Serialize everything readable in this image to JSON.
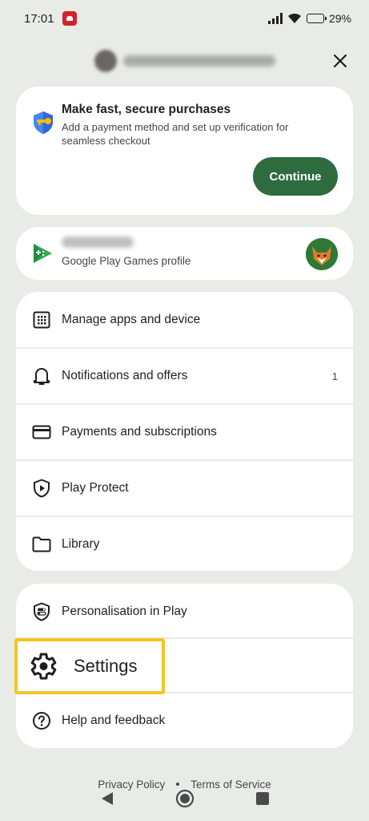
{
  "status_bar": {
    "time": "17:01",
    "battery_text": "29%",
    "battery_level": 0.29
  },
  "header": {
    "close_label": "×"
  },
  "promo": {
    "title": "Make fast, secure purchases",
    "subtitle": "Add a payment method and set up verification for seamless checkout",
    "button_label": "Continue"
  },
  "games_profile": {
    "label": "Google Play Games profile"
  },
  "menu": {
    "items": [
      {
        "label": "Manage apps and device",
        "icon": "grid-icon"
      },
      {
        "label": "Notifications and offers",
        "icon": "bell-icon",
        "count": "1"
      },
      {
        "label": "Payments and subscriptions",
        "icon": "credit-card-icon"
      },
      {
        "label": "Play Protect",
        "icon": "shield-play-icon"
      },
      {
        "label": "Library",
        "icon": "folder-icon"
      }
    ]
  },
  "menu2": {
    "items": [
      {
        "label": "Personalisation in Play",
        "icon": "shield-toggle-icon"
      },
      {
        "label": "Settings",
        "icon": "gear-icon"
      },
      {
        "label": "Help and feedback",
        "icon": "help-icon"
      }
    ]
  },
  "footer": {
    "privacy": "Privacy Policy",
    "terms": "Terms of Service"
  },
  "colors": {
    "accent": "#2e6b3e",
    "background": "#e9ece6",
    "highlight": "#f3c623"
  }
}
